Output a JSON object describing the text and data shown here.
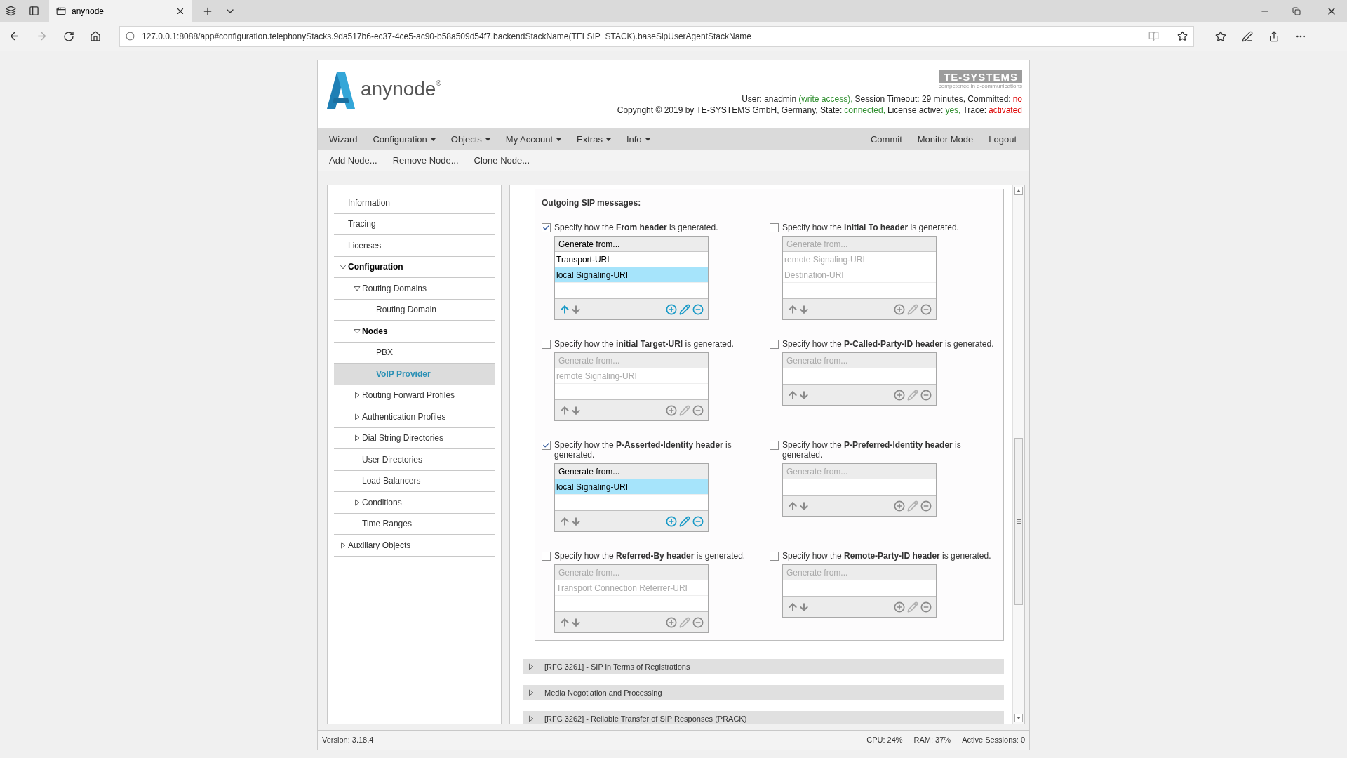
{
  "browser": {
    "tab_title": "anynode",
    "url": "127.0.0.1:8088/app#configuration.telephonyStacks.9da517b6-ec37-4ce5-ac90-b58a509d54f7.backendStackName(TELSIP_STACK).baseSipUserAgentStackName"
  },
  "header": {
    "logo_text": "anynode",
    "logo_mark": "®",
    "brand": "TE-SYSTEMS",
    "brand_tagline": "competence in e-communications",
    "user_line": [
      {
        "text": "User: anadmin",
        "color": "#222222"
      },
      {
        "text": "(write access),",
        "color": "#2f8f2f"
      },
      {
        "text": "Session Timeout: 29 minutes, Committed:",
        "color": "#222222"
      },
      {
        "text": "no",
        "color": "#dd0000"
      }
    ],
    "copyright_line": [
      {
        "text": "Copyright © 2019 by TE-SYSTEMS GmbH, Germany, State:",
        "color": "#222222"
      },
      {
        "text": "connected,",
        "color": "#2f8f2f"
      },
      {
        "text": "License active:",
        "color": "#222222"
      },
      {
        "text": "yes,",
        "color": "#2f8f2f"
      },
      {
        "text": "Trace:",
        "color": "#222222"
      },
      {
        "text": "activated",
        "color": "#dd0000"
      }
    ]
  },
  "menu": {
    "left": [
      {
        "label": "Wizard",
        "dropdown": false
      },
      {
        "label": "Configuration",
        "dropdown": true
      },
      {
        "label": "Objects",
        "dropdown": true
      },
      {
        "label": "My Account",
        "dropdown": true
      },
      {
        "label": "Extras",
        "dropdown": true
      },
      {
        "label": "Info",
        "dropdown": true
      }
    ],
    "right": [
      {
        "label": "Commit"
      },
      {
        "label": "Monitor Mode"
      },
      {
        "label": "Logout"
      }
    ]
  },
  "toolbar": [
    "Add Node...",
    "Remove Node...",
    "Clone Node..."
  ],
  "sidebar": {
    "items": [
      {
        "label": "Information",
        "active": false,
        "selected": false
      },
      {
        "label": "Tracing",
        "active": false,
        "selected": false
      },
      {
        "label": "Licenses",
        "active": false,
        "selected": false
      },
      {
        "label": "Configuration",
        "expanded": true,
        "active": true,
        "selected": false,
        "children": [
          {
            "label": "Routing Domains",
            "expanded": true,
            "active": false,
            "selected": false,
            "children": [
              {
                "label": "Routing Domain",
                "active": false,
                "selected": false
              }
            ]
          },
          {
            "label": "Nodes",
            "expanded": true,
            "active": true,
            "selected": false,
            "children": [
              {
                "label": "PBX",
                "active": false,
                "selected": false
              },
              {
                "label": "VoIP Provider",
                "active": true,
                "selected": true
              }
            ]
          },
          {
            "label": "Routing Forward Profiles",
            "expanded": false,
            "active": false,
            "selected": false
          },
          {
            "label": "Authentication Profiles",
            "expanded": false,
            "active": false,
            "selected": false
          },
          {
            "label": "Dial String Directories",
            "expanded": false,
            "active": false,
            "selected": false
          },
          {
            "label": "User Directories",
            "active": false,
            "selected": false
          },
          {
            "label": "Load Balancers",
            "active": false,
            "selected": false
          },
          {
            "label": "Conditions",
            "expanded": false,
            "active": false,
            "selected": false
          },
          {
            "label": "Time Ranges",
            "active": false,
            "selected": false
          }
        ]
      },
      {
        "label": "Auxiliary Objects",
        "expanded": false,
        "active": false,
        "selected": false
      }
    ]
  },
  "outgoing": {
    "title": "Outgoing SIP messages:",
    "settings": [
      {
        "label": "Specify how the **From header** is generated.",
        "checked": true,
        "list_header": "Generate from...",
        "entries": [
          {
            "text": "Transport-URI",
            "selected": false
          },
          {
            "text": "local Signaling-URI",
            "selected": true
          }
        ]
      },
      {
        "label": "Specify how the **initial To header** is generated.",
        "checked": false,
        "list_header": "Generate from...",
        "entries": [
          {
            "text": "remote Signaling-URI",
            "selected": false
          },
          {
            "text": "Destination-URI",
            "selected": false
          }
        ]
      },
      {
        "label": "Specify how the **initial Target-URI** is generated.",
        "checked": false,
        "list_header": "Generate from...",
        "entries": [
          {
            "text": "remote Signaling-URI",
            "selected": false
          }
        ]
      },
      {
        "label": "Specify how the **P-Called-Party-ID header** is generated.",
        "checked": false,
        "list_header": "Generate from..."
      },
      {
        "label": "Specify how the **P-Asserted-Identity header** is generated.",
        "checked": true,
        "list_header": "Generate from...",
        "entries": [
          {
            "text": "local Signaling-URI",
            "selected": true
          }
        ]
      },
      {
        "label": "Specify how the **P-Preferred-Identity header** is generated.",
        "checked": false,
        "list_header": "Generate from..."
      },
      {
        "label": "Specify how the **Referred-By header** is generated.",
        "checked": false,
        "list_header": "Generate from...",
        "entries": [
          {
            "text": "Transport Connection Referrer-URI",
            "selected": false
          }
        ]
      },
      {
        "label": "Specify how the **Remote-Party-ID header** is generated.",
        "checked": false,
        "list_header": "Generate from..."
      }
    ]
  },
  "sections": [
    {
      "label": "[RFC 3261] - SIP in Terms of Registrations",
      "expanded": false
    },
    {
      "label": "Media Negotiation and Processing",
      "expanded": false
    },
    {
      "label": "[RFC 3262] - Reliable Transfer of SIP Responses (PRACK)",
      "expanded": false
    }
  ],
  "status_bar": {
    "version": "Version: 3.18.4",
    "stats": [
      "CPU: 24%",
      "RAM: 37%",
      "Active Sessions: 0"
    ]
  }
}
